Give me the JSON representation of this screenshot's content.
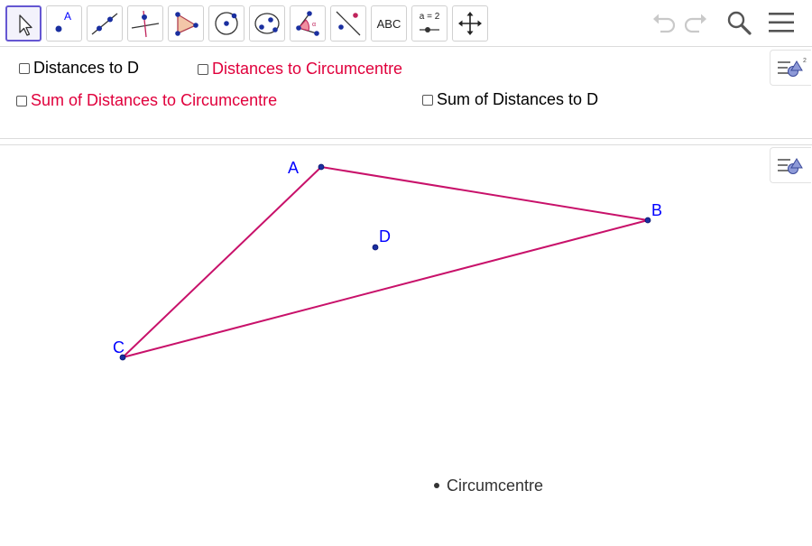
{
  "toolbar": {
    "text_tool_label": "ABC",
    "slider_tool_label": "a = 2",
    "point_tool_letter": "A",
    "active_color": "#6557d2"
  },
  "algebra": {
    "checkboxes": [
      {
        "label": "Distances to D",
        "checked": false,
        "color": "#000000"
      },
      {
        "label": "Distances to Circumcentre",
        "checked": false,
        "color": "#e0003c"
      },
      {
        "label": "Sum of Distances to Circumcentre",
        "checked": false,
        "color": "#e0003c"
      },
      {
        "label": "Sum of Distances to D",
        "checked": false,
        "color": "#000000"
      }
    ]
  },
  "graphics": {
    "points": {
      "A": {
        "label": "A"
      },
      "B": {
        "label": "B"
      },
      "C": {
        "label": "C"
      },
      "D": {
        "label": "D"
      }
    },
    "circumcentre_label": "Circumcentre",
    "triangle_color": "#c8116a",
    "point_label_color": "#0000ff"
  },
  "icons": [
    "move-icon",
    "point-icon",
    "line-icon",
    "perpendicular-line-icon",
    "polygon-icon",
    "circle-icon",
    "conic-icon",
    "angle-icon",
    "reflect-icon",
    "text-icon",
    "slider-icon",
    "move-graphics-view-icon",
    "undo-icon",
    "redo-icon",
    "search-icon",
    "menu-icon",
    "style-bar-icon"
  ]
}
